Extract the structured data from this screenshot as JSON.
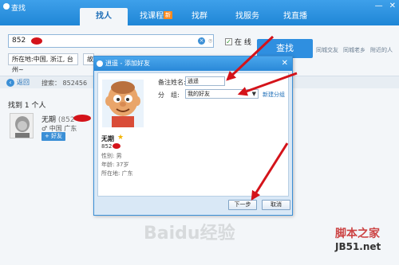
{
  "window": {
    "title": "查找",
    "minimize": "—",
    "close": "✕"
  },
  "tabs": [
    {
      "label": "找人"
    },
    {
      "label": "找课程",
      "badge": "新"
    },
    {
      "label": "找群"
    },
    {
      "label": "找服务"
    },
    {
      "label": "找直播"
    }
  ],
  "search": {
    "value": "852",
    "online_label": "在 线",
    "find_button": "查找",
    "quick_links": [
      "同城交友",
      "同城老乡",
      "附近的人"
    ],
    "filters": [
      "所在地:中国, 浙江, 台州~",
      "故"
    ]
  },
  "results": {
    "back_label": "返回",
    "search_echo": "搜索： 852456",
    "found_text": "找到 1 个人",
    "person": {
      "name": "无期",
      "id_prefix": "(852",
      "location": "中国 广东",
      "add_label": "+ 好友"
    }
  },
  "dialog": {
    "title": "逍遥 - 添加好友",
    "name": "无期",
    "number_prefix": "852",
    "gender": "性别: 男",
    "age": "年龄: 37岁",
    "location": "所在地: 广东",
    "remark_label": "备注姓名:",
    "remark_value": "逍遥",
    "group_label": "分　组:",
    "group_value": "我的好友",
    "new_group": "新建分组",
    "next_button": "下一步",
    "cancel_button": "取消"
  },
  "watermark": {
    "brand": "脚本之家",
    "site": "JB51.net",
    "baidu": "Baidu经验"
  },
  "colors": {
    "accent": "#2f8fe0",
    "titlebar": "#1f86d6",
    "arrow": "#d4131a"
  }
}
